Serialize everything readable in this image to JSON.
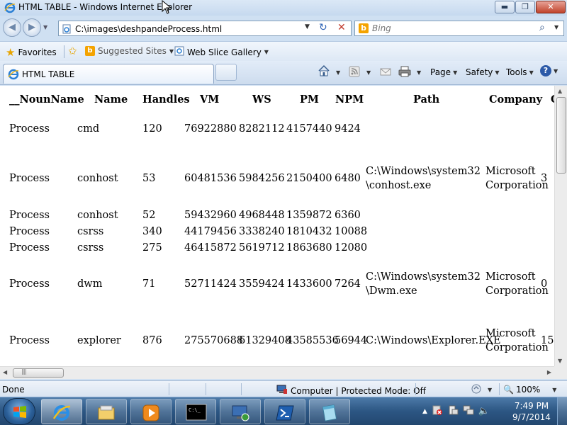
{
  "window": {
    "title": "HTML TABLE - Windows Internet Explorer",
    "buttons": {
      "minimize": "▬",
      "maximize": "❐",
      "close": "✕"
    }
  },
  "address_bar": {
    "url": "C:\\images\\deshpandeProcess.html",
    "refresh_icon": "↻",
    "stop_icon": "✕"
  },
  "search": {
    "placeholder": "Bing",
    "icon": "magnifier-icon"
  },
  "favorites_bar": {
    "favorites_label": "Favorites",
    "suggested_sites_label": "Suggested Sites",
    "web_slice_gallery_label": "Web Slice Gallery"
  },
  "tab": {
    "label": "HTML TABLE"
  },
  "command_bar": {
    "page_label": "Page",
    "safety_label": "Safety",
    "tools_label": "Tools",
    "help_label": "?"
  },
  "table": {
    "headers": [
      "__NounName",
      "Name",
      "Handles",
      "VM",
      "WS",
      "PM",
      "NPM",
      "Path",
      "Company",
      "C"
    ],
    "rows": [
      {
        "noun": "Process",
        "name": "cmd",
        "handles": "120",
        "vm": "76922880",
        "ws": "8282112",
        "pm": "4157440",
        "npm": "9424",
        "path1": "",
        "path2": "",
        "company1": "",
        "company2": "",
        "cpu": ""
      },
      {
        "noun": "Process",
        "name": "conhost",
        "handles": "53",
        "vm": "60481536",
        "ws": "5984256",
        "pm": "2150400",
        "npm": "6480",
        "path1": "C:\\Windows\\system32",
        "path2": "\\conhost.exe",
        "company1": "Microsoft",
        "company2": "Corporation",
        "cpu": "3"
      },
      {
        "noun": "Process",
        "name": "conhost",
        "handles": "52",
        "vm": "59432960",
        "ws": "4968448",
        "pm": "1359872",
        "npm": "6360",
        "path1": "",
        "path2": "",
        "company1": "",
        "company2": "",
        "cpu": ""
      },
      {
        "noun": "Process",
        "name": "csrss",
        "handles": "340",
        "vm": "44179456",
        "ws": "3338240",
        "pm": "1810432",
        "npm": "10088",
        "path1": "",
        "path2": "",
        "company1": "",
        "company2": "",
        "cpu": ""
      },
      {
        "noun": "Process",
        "name": "csrss",
        "handles": "275",
        "vm": "46415872",
        "ws": "5619712",
        "pm": "1863680",
        "npm": "12080",
        "path1": "",
        "path2": "",
        "company1": "",
        "company2": "",
        "cpu": ""
      },
      {
        "noun": "Process",
        "name": "dwm",
        "handles": "71",
        "vm": "52711424",
        "ws": "3559424",
        "pm": "1433600",
        "npm": "7264",
        "path1": "C:\\Windows\\system32",
        "path2": "\\Dwm.exe",
        "company1": "Microsoft",
        "company2": "Corporation",
        "cpu": "0"
      },
      {
        "noun": "Process",
        "name": "explorer",
        "handles": "876",
        "vm": "275570688",
        "ws": "61329408",
        "pm": "43585536",
        "npm": "56944",
        "path1": "C:\\Windows\\Explorer.EXE",
        "path2": "",
        "company1": "Microsoft",
        "company2": "Corporation",
        "cpu": "15."
      }
    ]
  },
  "status_bar": {
    "status": "Done",
    "zone": "Computer | Protected Mode: Off",
    "zoom": "100%"
  },
  "taskbar": {
    "time": "7:49 PM",
    "date": "9/7/2014"
  },
  "colors": {
    "chrome": "#cfe0f2",
    "taskbar": "#2c5683",
    "close_button": "#c0432b",
    "bing": "#f4a300"
  }
}
